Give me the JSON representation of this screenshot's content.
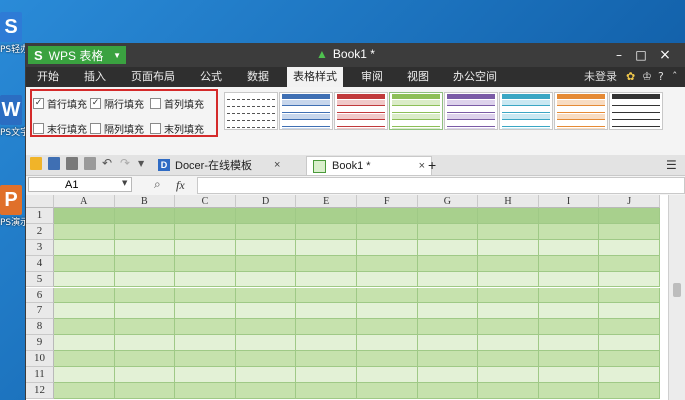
{
  "desktop": {
    "icons": [
      {
        "label": "PS轻办",
        "letter": "S",
        "color": "#2e7bd6"
      },
      {
        "label": "PS文字",
        "letter": "W",
        "color": "#2b6dc2"
      },
      {
        "label": "PS演示",
        "letter": "P",
        "color": "#e0702a"
      }
    ]
  },
  "titlebar": {
    "app_name": "WPS 表格",
    "app_logo": "S",
    "doc_title": "Book1 *",
    "min": "–",
    "max": "□",
    "close": "×",
    "app_color": "#3aa240"
  },
  "menubar": {
    "items": [
      "开始",
      "插入",
      "页面布局",
      "公式",
      "数据",
      "表格样式",
      "审阅",
      "视图",
      "办公空间"
    ],
    "active": "表格样式",
    "login": "未登录"
  },
  "table_style_options": {
    "first_row": {
      "label": "首行填充",
      "checked": true
    },
    "alt_rows": {
      "label": "隔行填充",
      "checked": true
    },
    "first_col": {
      "label": "首列填充",
      "checked": false
    },
    "last_row": {
      "label": "末行填充",
      "checked": false
    },
    "alt_cols": {
      "label": "隔列填充",
      "checked": false
    },
    "last_col": {
      "label": "末列填充",
      "checked": false
    },
    "highlight_color": "#d42a2a"
  },
  "style_gallery": [
    {
      "header": "#ffffff",
      "band": "#ffffff",
      "line": "#555555"
    },
    {
      "header": "#3f6fb3",
      "band": "#c7d6ec",
      "line": "#3f6fb3"
    },
    {
      "header": "#c0393b",
      "band": "#f0c9c9",
      "line": "#c0393b"
    },
    {
      "header": "#8dbf58",
      "band": "#dbecc8",
      "line": "#8dbf58"
    },
    {
      "header": "#7a5ba6",
      "band": "#ddd2ec",
      "line": "#7a5ba6"
    },
    {
      "header": "#3aa6c4",
      "band": "#c9e8f2",
      "line": "#3aa6c4"
    },
    {
      "header": "#e58a35",
      "band": "#f8dcc2",
      "line": "#e58a35"
    },
    {
      "header": "#333333",
      "band": "#ffffff",
      "line": "#333333"
    }
  ],
  "tabs": {
    "docer": "Docer-在线模板",
    "book": "Book1 *",
    "add": "+"
  },
  "formula": {
    "cell_ref": "A1",
    "fx": "fx",
    "value": ""
  },
  "sheet": {
    "columns": [
      "A",
      "B",
      "C",
      "D",
      "E",
      "F",
      "G",
      "H",
      "I",
      "J"
    ],
    "rows": [
      "1",
      "2",
      "3",
      "4",
      "5",
      "6",
      "7",
      "8",
      "9",
      "10",
      "11",
      "12"
    ],
    "header_fill": "#a8d08d",
    "band_fill_a": "#c6e2ad",
    "band_fill_b": "#e3f1d6"
  }
}
